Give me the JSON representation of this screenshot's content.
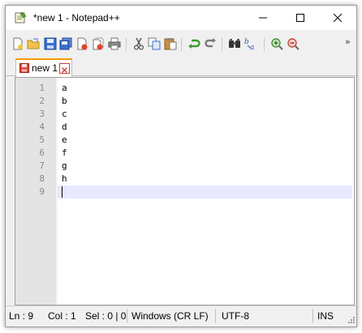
{
  "window": {
    "title": "*new 1 - Notepad++",
    "icon": "notepad-icon"
  },
  "window_controls": [
    "minimize-icon",
    "maximize-icon",
    "close-icon"
  ],
  "toolbar": {
    "icons": [
      "new-file-icon",
      "open-file-icon",
      "save-icon",
      "save-all-icon",
      "close-icon",
      "close-all-icon",
      "print-icon",
      "cut-icon",
      "copy-icon",
      "paste-icon",
      "undo-icon",
      "redo-icon",
      "find-icon",
      "replace-icon",
      "zoom-in-icon",
      "zoom-out-icon"
    ],
    "more": "»"
  },
  "tabs": [
    {
      "label": "new 1",
      "modified": true
    }
  ],
  "editor": {
    "lines": [
      {
        "num": "1",
        "text": "a"
      },
      {
        "num": "2",
        "text": "b"
      },
      {
        "num": "3",
        "text": "c"
      },
      {
        "num": "4",
        "text": "d"
      },
      {
        "num": "5",
        "text": "e"
      },
      {
        "num": "6",
        "text": "f"
      },
      {
        "num": "7",
        "text": "g"
      },
      {
        "num": "8",
        "text": "h"
      },
      {
        "num": "9",
        "text": ""
      }
    ],
    "current_line": 9
  },
  "status": {
    "ln": "Ln : 9",
    "col": "Col : 1",
    "sel": "Sel : 0 | 0",
    "eol": "Windows (CR LF)",
    "encoding": "UTF-8",
    "mode": "INS"
  },
  "colors": {
    "tab_accent": "#f79a00",
    "current_line_bg": "#e8e8ff",
    "gutter_bg": "#e4e4e4"
  }
}
